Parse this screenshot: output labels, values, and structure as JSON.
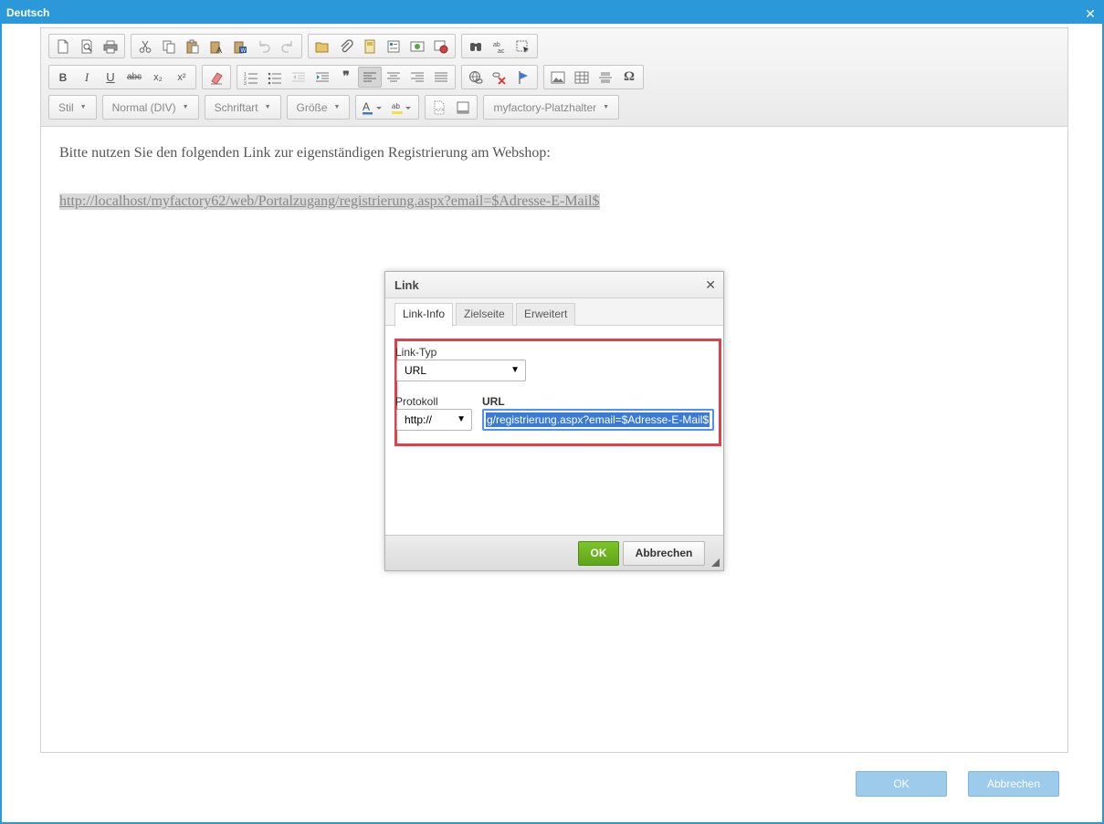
{
  "window": {
    "title": "Deutsch",
    "close_glyph": "✕",
    "ok_label": "OK",
    "cancel_label": "Abbrechen",
    "accent_color": "#2b98d9"
  },
  "toolbar": {
    "combos": {
      "style": "Stil",
      "format": "Normal (DIV)",
      "font": "Schriftart",
      "size": "Größe",
      "placeholder": "myfactory-Platzhalter"
    },
    "text_glyphs": {
      "bold": "B",
      "italic": "I",
      "underline": "U",
      "strike": "abc",
      "subscript": "x₂",
      "superscript": "x²",
      "blockquote": "❞",
      "special_char": "Ω"
    }
  },
  "content": {
    "paragraph": "Bitte nutzen Sie den folgenden Link zur eigenständigen Registrierung am Webshop:",
    "link_text": "http://localhost/myfactory62/web/Portalzugang/registrierung.aspx?email=$Adresse-E-Mail$"
  },
  "link_dialog": {
    "title": "Link",
    "close_glyph": "✕",
    "tabs": [
      "Link-Info",
      "Zielseite",
      "Erweitert"
    ],
    "link_type_label": "Link-Typ",
    "link_type_value": "URL",
    "protocol_label": "Protokoll",
    "protocol_value": "http://",
    "url_label": "URL",
    "url_value": "g/registrierung.aspx?email=$Adresse-E-Mail$",
    "ok_label": "OK",
    "cancel_label": "Abbrechen",
    "ok_color": "#6cb524",
    "highlight_color": "#e0404a"
  }
}
